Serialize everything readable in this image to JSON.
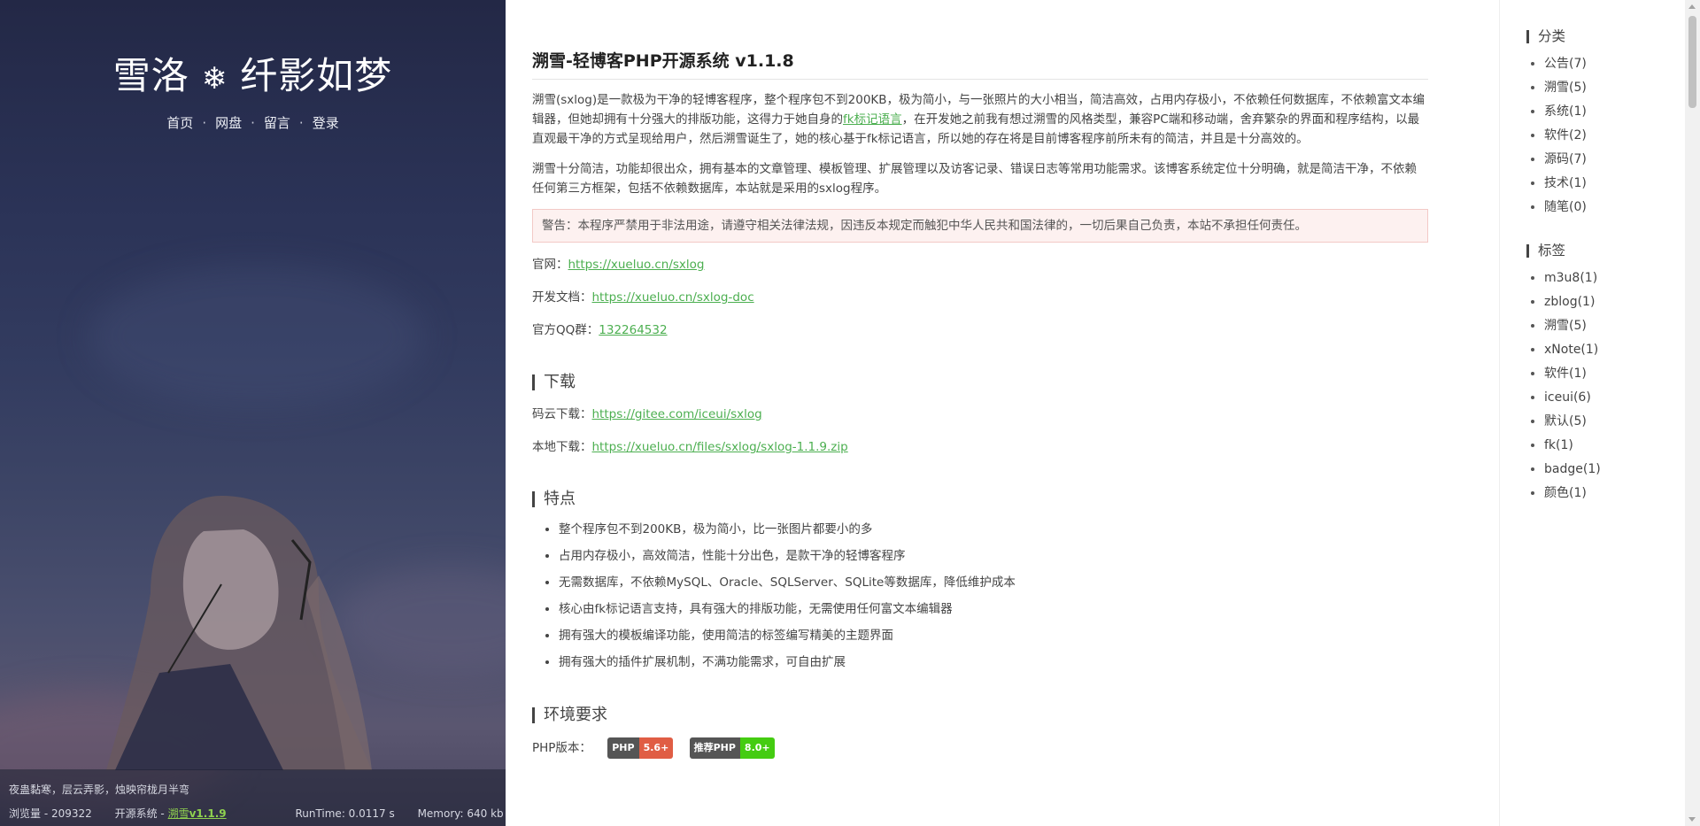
{
  "site": {
    "title_left": "雪洛",
    "title_icon": "❄",
    "title_right": "纤影如梦"
  },
  "nav": {
    "items": [
      "首页",
      "网盘",
      "留言",
      "登录"
    ],
    "separator": "·"
  },
  "footer": {
    "motto": "夜蛊黏寒，层云弄影，烛映帘栊月半弯",
    "views_label": "浏览量 - 209322",
    "system_prefix": "开源系统 -",
    "system_name": "溯雪",
    "system_version": "v1.1.9",
    "runtime": "RunTime: 0.0117 s",
    "memory": "Memory: 640 kb"
  },
  "post": {
    "title": "溯雪-轻博客PHP开源系统 v1.1.8",
    "p1_a": "溯雪(sxlog)是一款极为干净的轻博客程序，整个程序包不到200KB，极为简小，与一张照片的大小相当，简洁高效，占用内存极小，不依赖任何数据库，不依赖富文本编辑器，但她却拥有十分强大的排版功能，这得力于她自身的",
    "p1_link": "fk标记语言",
    "p1_b": "，在开发她之前我有想过溯雪的风格类型，兼容PC端和移动端，舍弃繁杂的界面和程序结构，以最直观最干净的方式呈现给用户，然后溯雪诞生了，她的核心基于fk标记语言，所以她的存在将是目前博客程序前所未有的简洁，并且是十分高效的。",
    "p2": "溯雪十分简洁，功能却很出众，拥有基本的文章管理、模板管理、扩展管理以及访客记录、错误日志等常用功能需求。该博客系统定位十分明确，就是简洁干净，不依赖任何第三方框架，包括不依赖数据库，本站就是采用的sxlog程序。",
    "warning": "警告：本程序严禁用于非法用途，请遵守相关法律法规，因违反本规定而触犯中华人民共和国法律的，一切后果自己负责，本站不承担任何责任。",
    "official_label": "官网：",
    "official_url": "https://xueluo.cn/sxlog",
    "doc_label": "开发文档：",
    "doc_url": "https://xueluo.cn/sxlog-doc",
    "qq_label": "官方QQ群：",
    "qq_number": "132264532"
  },
  "download": {
    "heading": "下载",
    "gitee_label": "码云下载：",
    "gitee_url": "https://gitee.com/iceui/sxlog",
    "local_label": "本地下载：",
    "local_url": "https://xueluo.cn/files/sxlog/sxlog-1.1.9.zip"
  },
  "features": {
    "heading": "特点",
    "items": [
      "整个程序包不到200KB，极为简小，比一张图片都要小的多",
      "占用内存极小，高效简洁，性能十分出色，是款干净的轻博客程序",
      "无需数据库，不依赖MySQL、Oracle、SQLServer、SQLite等数据库，降低维护成本",
      "核心由fk标记语言支持，具有强大的排版功能，无需使用任何富文本编辑器",
      "拥有强大的模板编译功能，使用简洁的标签编写精美的主题界面",
      "拥有强大的插件扩展机制，不满功能需求，可自由扩展"
    ]
  },
  "env": {
    "heading": "环境要求",
    "php_label": "PHP版本：",
    "badge1_left": "PHP",
    "badge1_right": "5.6+",
    "badge1_color": "#e05d44",
    "badge2_left": "推荐PHP",
    "badge2_right": "8.0+",
    "badge2_color": "#4c1"
  },
  "sidebar": {
    "categories_title": "分类",
    "categories": [
      "公告(7)",
      "溯雪(5)",
      "系统(1)",
      "软件(2)",
      "源码(7)",
      "技术(1)",
      "随笔(0)"
    ],
    "tags_title": "标签",
    "tags": [
      "m3u8(1)",
      "zblog(1)",
      "溯雪(5)",
      "xNote(1)",
      "软件(1)",
      "iceui(6)",
      "默认(5)",
      "fk(1)",
      "badge(1)",
      "颜色(1)"
    ]
  }
}
